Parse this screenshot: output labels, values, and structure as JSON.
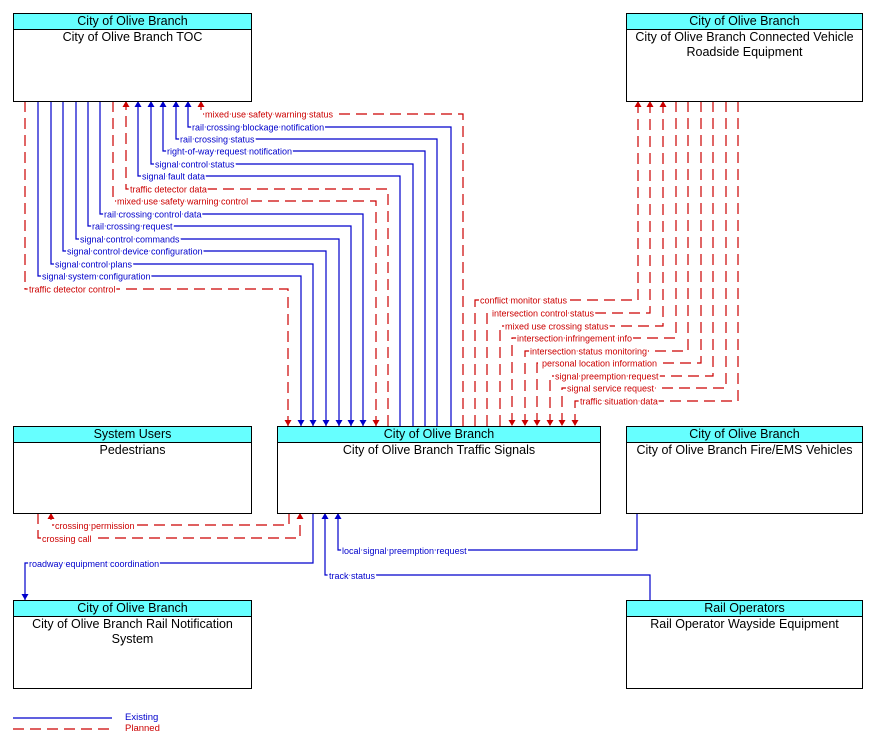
{
  "colors": {
    "existing": "#0000CC",
    "planned": "#CC0000",
    "header": "#66FFFF"
  },
  "elements": {
    "toc": {
      "agency": "City of Olive Branch",
      "name": "City of Olive Branch TOC"
    },
    "cv": {
      "agency": "City of Olive Branch",
      "name": "City of Olive Branch Connected Vehicle Roadside Equipment"
    },
    "pedestrians": {
      "agency": "System Users",
      "name": "Pedestrians"
    },
    "signals": {
      "agency": "City of Olive Branch",
      "name": "City of Olive Branch Traffic Signals"
    },
    "fire": {
      "agency": "City of Olive Branch",
      "name": "City of Olive Branch Fire/EMS Vehicles"
    },
    "railnotif": {
      "agency": "City of Olive Branch",
      "name": "City of Olive Branch Rail Notification System"
    },
    "wayside": {
      "agency": "Rail Operators",
      "name": "Rail Operator Wayside Equipment"
    }
  },
  "flows": [
    {
      "label": "mixed use safety warning status",
      "status": "planned",
      "from": "signals",
      "to": "toc"
    },
    {
      "label": "rail crossing blockage notification",
      "status": "existing",
      "from": "signals",
      "to": "toc"
    },
    {
      "label": "rail crossing status",
      "status": "existing",
      "from": "signals",
      "to": "toc"
    },
    {
      "label": "right-of-way request notification",
      "status": "existing",
      "from": "signals",
      "to": "toc"
    },
    {
      "label": "signal control status",
      "status": "existing",
      "from": "signals",
      "to": "toc"
    },
    {
      "label": "signal fault data",
      "status": "existing",
      "from": "signals",
      "to": "toc"
    },
    {
      "label": "traffic detector data",
      "status": "planned",
      "from": "signals",
      "to": "toc"
    },
    {
      "label": "mixed use safety warning control",
      "status": "planned",
      "from": "toc",
      "to": "signals"
    },
    {
      "label": "rail crossing control data",
      "status": "existing",
      "from": "toc",
      "to": "signals"
    },
    {
      "label": "rail crossing request",
      "status": "existing",
      "from": "toc",
      "to": "signals"
    },
    {
      "label": "signal control commands",
      "status": "existing",
      "from": "toc",
      "to": "signals"
    },
    {
      "label": "signal control device configuration",
      "status": "existing",
      "from": "toc",
      "to": "signals"
    },
    {
      "label": "signal control plans",
      "status": "existing",
      "from": "toc",
      "to": "signals"
    },
    {
      "label": "signal system configuration",
      "status": "existing",
      "from": "toc",
      "to": "signals"
    },
    {
      "label": "traffic detector control",
      "status": "planned",
      "from": "toc",
      "to": "signals"
    },
    {
      "label": "conflict monitor status",
      "status": "planned",
      "from": "signals",
      "to": "cv"
    },
    {
      "label": "intersection control status",
      "status": "planned",
      "from": "signals",
      "to": "cv"
    },
    {
      "label": "mixed use crossing status",
      "status": "planned",
      "from": "signals",
      "to": "cv"
    },
    {
      "label": "intersection infringement info",
      "status": "planned",
      "from": "cv",
      "to": "signals"
    },
    {
      "label": "intersection status monitoring",
      "status": "planned",
      "from": "cv",
      "to": "signals"
    },
    {
      "label": "personal location information",
      "status": "planned",
      "from": "cv",
      "to": "signals"
    },
    {
      "label": "signal preemption request",
      "status": "planned",
      "from": "cv",
      "to": "signals"
    },
    {
      "label": "signal service request",
      "status": "planned",
      "from": "cv",
      "to": "signals"
    },
    {
      "label": "traffic situation data",
      "status": "planned",
      "from": "cv",
      "to": "signals"
    },
    {
      "label": "crossing permission",
      "status": "planned",
      "from": "signals",
      "to": "pedestrians"
    },
    {
      "label": "crossing call",
      "status": "planned",
      "from": "pedestrians",
      "to": "signals"
    },
    {
      "label": "roadway equipment coordination",
      "status": "existing",
      "from": "signals",
      "to": "railnotif"
    },
    {
      "label": "local signal preemption request",
      "status": "existing",
      "from": "fire",
      "to": "signals"
    },
    {
      "label": "track status",
      "status": "existing",
      "from": "wayside",
      "to": "signals"
    }
  ],
  "legend": {
    "existing": "Existing",
    "planned": "Planned"
  }
}
